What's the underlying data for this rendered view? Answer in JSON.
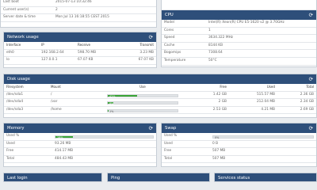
{
  "system": {
    "rows": [
      {
        "label": "Last boot",
        "value": "2015-07-13 10:32:46"
      },
      {
        "label": "Current user(s)",
        "value": "2"
      },
      {
        "label": "Server date & time",
        "value": "Mon Jul 13 16:18:55 CEST 2015"
      }
    ]
  },
  "cpu": {
    "title": "CPU",
    "rows": [
      {
        "label": "Model",
        "value": "Intel(R) Xeon(R) CPU E5-1620 v2 @ 3.70GHz"
      },
      {
        "label": "Cores",
        "value": "1"
      },
      {
        "label": "Speed",
        "value": "3634.322 MHz"
      },
      {
        "label": "Cache",
        "value": "8144 KB"
      },
      {
        "label": "Bogomips",
        "value": "7308.64"
      },
      {
        "label": "Temperature",
        "value": "50°C"
      }
    ]
  },
  "network": {
    "title": "Network usage",
    "headers": [
      "Interface",
      "IP",
      "Receive",
      "Transmit"
    ],
    "rows": [
      {
        "iface": "eth0",
        "ip": "192.168.2.64",
        "receive": "598.70 MB",
        "transmit": "3.23 MB"
      },
      {
        "iface": "lo",
        "ip": "127.0.0.1",
        "receive": "67.07 KB",
        "transmit": "67.07 KB"
      }
    ]
  },
  "disk": {
    "title": "Disk usage",
    "headers": [
      "Filesystem",
      "Mount",
      "Use",
      "Free",
      "Used",
      "Total"
    ],
    "rows": [
      {
        "fs": "/dev/sda1",
        "mount": "/",
        "pct": "42%",
        "pct_value": 42,
        "free": "1.42 GB",
        "used": "515.57 MB",
        "total": "2.36 GB"
      },
      {
        "fs": "/dev/sda4",
        "mount": "/var",
        "pct": "8%",
        "pct_value": 8,
        "free": "2 GB",
        "used": "212.04 MB",
        "total": "2.34 GB"
      },
      {
        "fs": "/dev/sda3",
        "mount": "/home",
        "pct": "1%",
        "pct_value": 1,
        "free": "2.53 GB",
        "used": "4.21 MB",
        "total": "2.69 GB"
      }
    ]
  },
  "memory": {
    "title": "Memory",
    "used_pct": "18%",
    "used_pct_value": 18,
    "rows": [
      {
        "label": "Used %",
        "value": ""
      },
      {
        "label": "Used",
        "value": "93.26 MB"
      },
      {
        "label": "Free",
        "value": "414.17 MB"
      },
      {
        "label": "Total",
        "value": "484.43 MB"
      }
    ]
  },
  "swap": {
    "title": "Swap",
    "used_pct": "0%",
    "used_pct_value": 0,
    "rows": [
      {
        "label": "Used %",
        "value": ""
      },
      {
        "label": "Used",
        "value": "0 B"
      },
      {
        "label": "Free",
        "value": "507 MB"
      },
      {
        "label": "Total",
        "value": "507 MB"
      }
    ]
  },
  "bottom": {
    "last_login": "Last login",
    "ping": "Ping",
    "services": "Services status"
  },
  "colors": {
    "header": "#2e4f7a",
    "bar": "#3aa537"
  },
  "icons": {
    "refresh": "refresh-icon"
  }
}
